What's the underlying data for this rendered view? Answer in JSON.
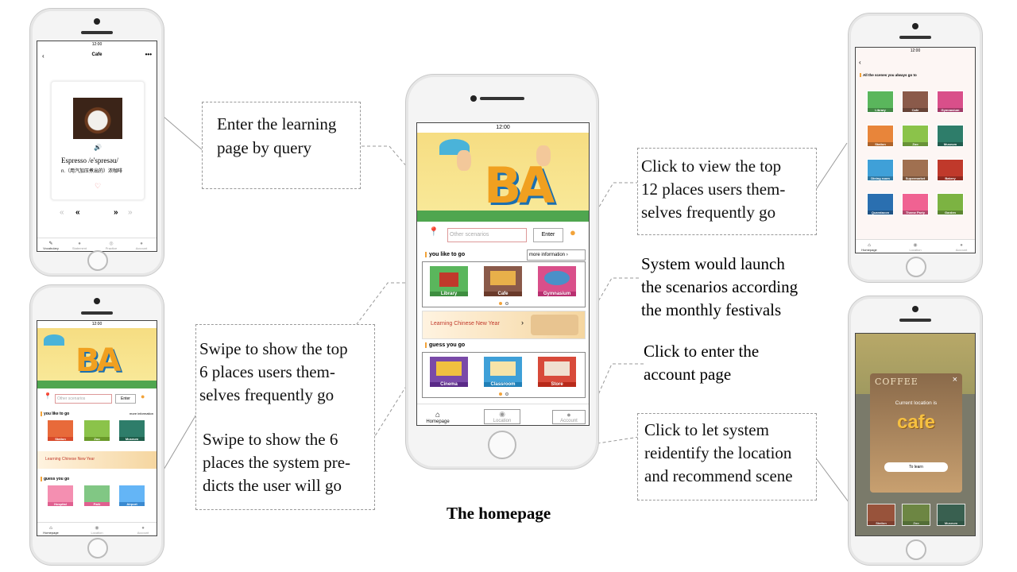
{
  "caption": "The homepage",
  "callouts": {
    "query": [
      "Enter the learning",
      "page by query"
    ],
    "top12": [
      "Click to view the top",
      "12 places users them-",
      "selves frequently go"
    ],
    "festival": [
      "System would launch",
      "the scenarios according",
      "the monthly festivals"
    ],
    "account": [
      "Click to enter the",
      "account page"
    ],
    "reidentify": [
      "Click to let system",
      "reidentify the location",
      "and recommend scene"
    ],
    "swipe_top6": [
      "Swipe to show the top",
      "6 places users them-",
      "selves frequently go"
    ],
    "swipe_predict": [
      "Swipe to show the 6",
      "places the system pre-",
      "dicts the user will go"
    ]
  },
  "status_time": "12:00",
  "homepage": {
    "search_placeholder": "Other scenarios",
    "enter_label": "Enter",
    "section1_title": "you like to go",
    "more_info": "more information",
    "section1_items": [
      "Library",
      "Cafe",
      "Gymnasium"
    ],
    "festival_banner": "Learning Chinese New Year",
    "section2_title": "guess you go",
    "section2_items": [
      "Cinema",
      "Classroom",
      "Store"
    ],
    "tabs": [
      "Homepage",
      "Location",
      "Account"
    ]
  },
  "learning_page": {
    "title": "Cafe",
    "word": "Espresso",
    "phonetic": "/e'spresəu/",
    "definition": "n.（用汽加压煮出的）浓咖啡",
    "tabs": [
      "Vocabulary",
      "Statement",
      "Practice",
      "Account"
    ]
  },
  "homepage_alt": {
    "search_placeholder": "Other scenarios",
    "enter_label": "Enter",
    "section1_title": "you like to go",
    "more_info": "more information",
    "section1_items": [
      "Station",
      "Zoo",
      "Museum"
    ],
    "festival_banner": "Learning Chinese New Year",
    "section2_title": "guess you go",
    "section2_items": [
      "Hospital",
      "Park",
      "Airport"
    ],
    "tabs": [
      "Homepage",
      "Location",
      "Account"
    ]
  },
  "scenes_page": {
    "title": "All the scenes you always go to",
    "items": [
      "Library",
      "Cafe",
      "Gymnasium",
      "Station",
      "Zoo",
      "Museum",
      "Dining room",
      "Supermarket",
      "Bakery",
      "Quaratacon",
      "Theme Party",
      "Garden"
    ],
    "tabs": [
      "Homepage",
      "Location",
      "Account"
    ]
  },
  "location_popup": {
    "banner_text": "COFFEE",
    "close": "×",
    "current_location_label": "Current location is",
    "location_name": "cafe",
    "to_learn": "To learn",
    "bottom_items": [
      "Station",
      "Zoo",
      "Museum"
    ]
  },
  "colors": {
    "accent_orange": "#f2a33a",
    "callout_border": "#999999",
    "tile_colors": [
      "#5ab65c",
      "#8a5a4a",
      "#d94f8a",
      "#7a4aa8",
      "#3fa0d8",
      "#d84a3a"
    ]
  }
}
